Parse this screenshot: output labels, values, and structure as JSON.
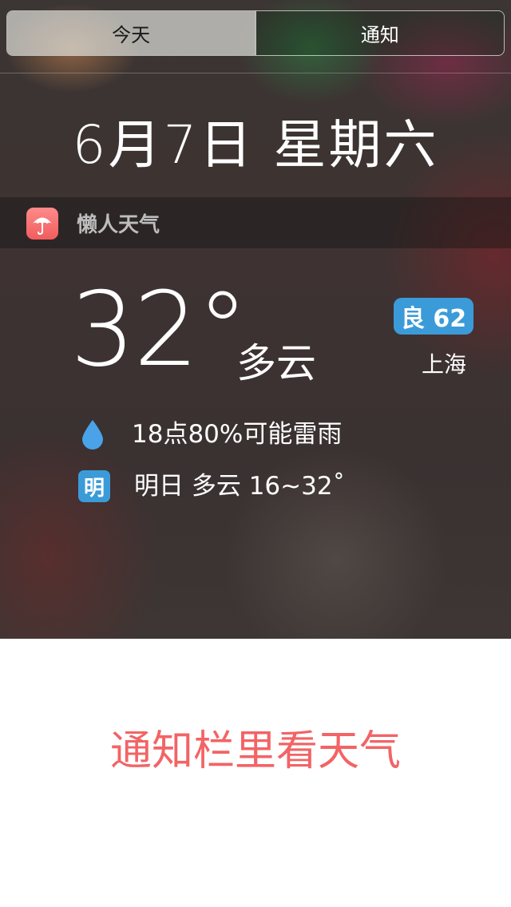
{
  "segmented": {
    "today_label": "今天",
    "notifications_label": "通知"
  },
  "date_line": "6月7日 星期六",
  "widget": {
    "app_name": "懒人天气",
    "icon": "umbrella-icon"
  },
  "weather": {
    "temperature": "32°",
    "condition": "多云",
    "aqi": "良 62",
    "city": "上海",
    "rain_icon": "raindrop-icon",
    "rain_forecast": "18点80%可能雷雨",
    "tomorrow_badge": "明",
    "tomorrow_forecast": "明日 多云 16~32˚"
  },
  "colors": {
    "accent_blue": "#3b9bd8",
    "app_icon_red": "#f05d5d",
    "promo_red": "#f26466"
  },
  "promo_text": "通知栏里看天气"
}
